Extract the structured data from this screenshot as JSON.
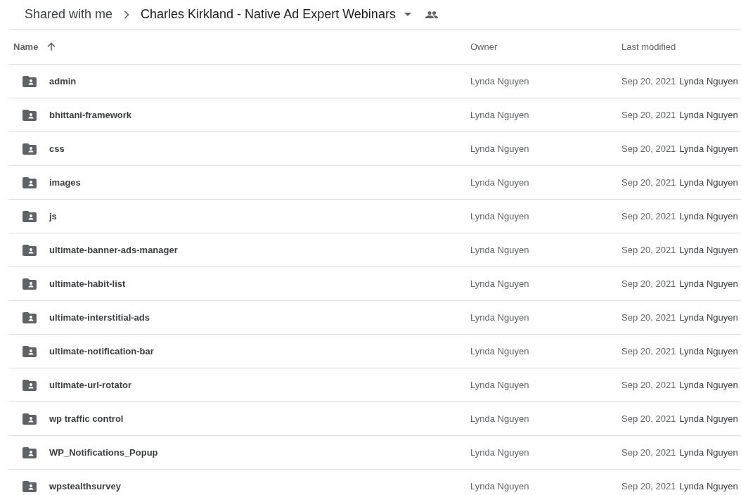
{
  "breadcrumb": {
    "parent": "Shared with me",
    "current": "Charles Kirkland - Native Ad Expert Webinars"
  },
  "table": {
    "columns": [
      {
        "label": "Name",
        "sorted": true
      },
      {
        "label": "Owner",
        "sorted": false
      },
      {
        "label": "Last modified",
        "sorted": false
      }
    ],
    "rows": [
      {
        "name": "admin",
        "owner": "Lynda Nguyen",
        "modified": "Sep 20, 2021",
        "modified_by": "Lynda Nguyen"
      },
      {
        "name": "bhittani-framework",
        "owner": "Lynda Nguyen",
        "modified": "Sep 20, 2021",
        "modified_by": "Lynda Nguyen"
      },
      {
        "name": "css",
        "owner": "Lynda Nguyen",
        "modified": "Sep 20, 2021",
        "modified_by": "Lynda Nguyen"
      },
      {
        "name": "images",
        "owner": "Lynda Nguyen",
        "modified": "Sep 20, 2021",
        "modified_by": "Lynda Nguyen"
      },
      {
        "name": "js",
        "owner": "Lynda Nguyen",
        "modified": "Sep 20, 2021",
        "modified_by": "Lynda Nguyen"
      },
      {
        "name": "ultimate-banner-ads-manager",
        "owner": "Lynda Nguyen",
        "modified": "Sep 20, 2021",
        "modified_by": "Lynda Nguyen"
      },
      {
        "name": "ultimate-habit-list",
        "owner": "Lynda Nguyen",
        "modified": "Sep 20, 2021",
        "modified_by": "Lynda Nguyen"
      },
      {
        "name": "ultimate-interstitial-ads",
        "owner": "Lynda Nguyen",
        "modified": "Sep 20, 2021",
        "modified_by": "Lynda Nguyen"
      },
      {
        "name": "ultimate-notification-bar",
        "owner": "Lynda Nguyen",
        "modified": "Sep 20, 2021",
        "modified_by": "Lynda Nguyen"
      },
      {
        "name": "ultimate-url-rotator",
        "owner": "Lynda Nguyen",
        "modified": "Sep 20, 2021",
        "modified_by": "Lynda Nguyen"
      },
      {
        "name": "wp traffic control",
        "owner": "Lynda Nguyen",
        "modified": "Sep 20, 2021",
        "modified_by": "Lynda Nguyen"
      },
      {
        "name": "WP_Notifications_Popup",
        "owner": "Lynda Nguyen",
        "modified": "Sep 20, 2021",
        "modified_by": "Lynda Nguyen"
      },
      {
        "name": "wpstealthsurvey",
        "owner": "Lynda Nguyen",
        "modified": "Sep 20, 2021",
        "modified_by": "Lynda Nguyen"
      }
    ]
  }
}
